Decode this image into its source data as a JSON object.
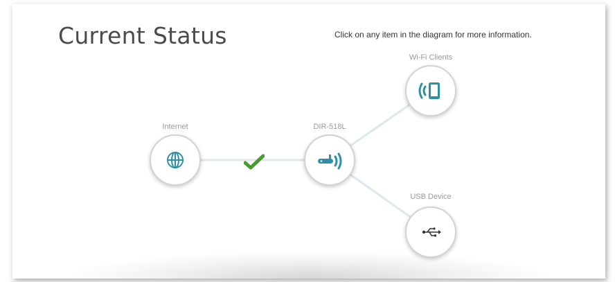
{
  "page": {
    "title": "Current Status",
    "hint": "Click on any item in the diagram for more information."
  },
  "nodes": {
    "internet": {
      "label": "Internet",
      "icon": "globe-icon"
    },
    "router": {
      "label": "DIR-518L",
      "icon": "router-icon"
    },
    "wifi_clients": {
      "label": "Wi-Fi Clients",
      "icon": "wifi-tablet-icon"
    },
    "usb_device": {
      "label": "USB Device",
      "icon": "usb-icon"
    }
  },
  "connection": {
    "internet_status_icon": "checkmark-icon"
  },
  "colors": {
    "accent": "#2e8fa8",
    "check": "#4a9a2e",
    "node_border": "#d3d3d3",
    "link": "#dce7ee"
  }
}
